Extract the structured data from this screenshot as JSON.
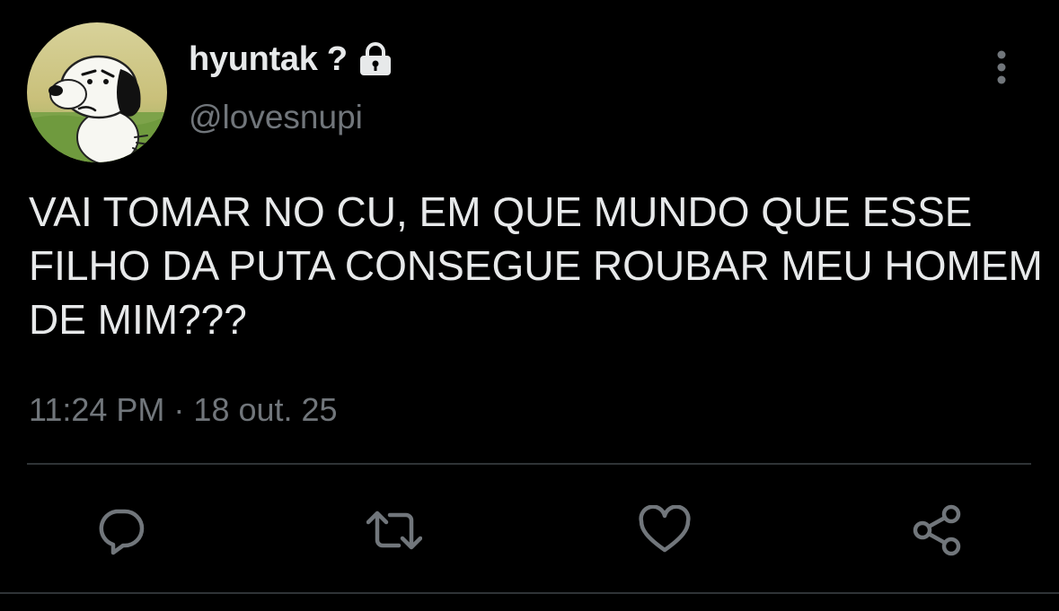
{
  "tweet": {
    "display_name": "hyuntak ?",
    "handle": "@lovesnupi",
    "text": "VAI TOMAR NO CU, EM QUE MUNDO QUE ESSE FILHO DA PUTA CONSEGUE ROUBAR MEU HOMEM DE MIM???",
    "time": "11:24 PM",
    "separator": "·",
    "date": "18 out. 25",
    "protected": true
  },
  "icons": {
    "avatar": "snoopy-avatar",
    "lock": "lock-icon",
    "more": "more-vertical-icon",
    "reply": "reply-icon",
    "retweet": "retweet-icon",
    "like": "heart-icon",
    "share": "share-icon"
  },
  "colors": {
    "background": "#000000",
    "primary_text": "#e7e9ea",
    "secondary_text": "#71767b",
    "divider": "#2f3336"
  }
}
